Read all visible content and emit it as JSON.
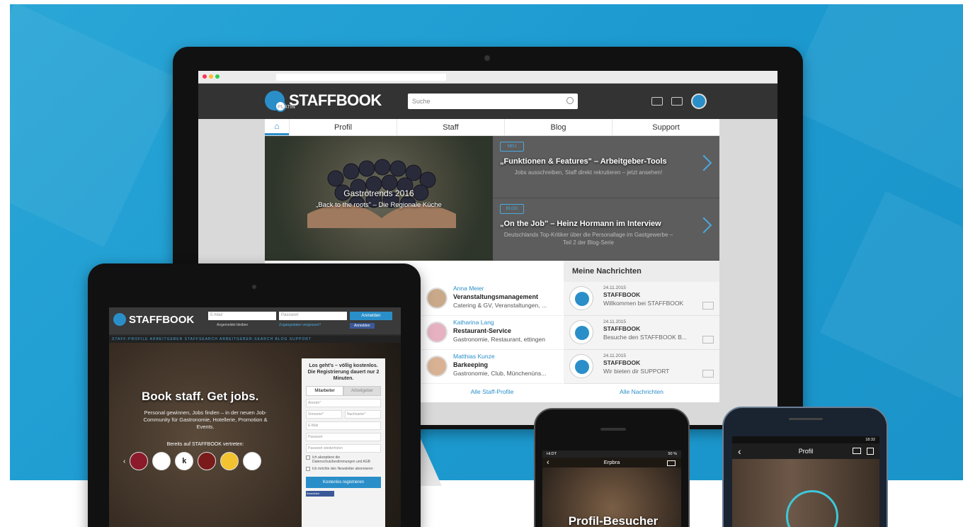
{
  "monitor": {
    "brand": "STAFFBOOK",
    "brand_sub": "PLATIN",
    "search_placeholder": "Suche",
    "nav": [
      "Profil",
      "Staff",
      "Blog",
      "Support"
    ],
    "hero": {
      "title": "Gastrotrends 2016",
      "subtitle": "„Back to the roots\" – Die Regionale Küche"
    },
    "teasers": [
      {
        "tag": "NEU",
        "title": "„Funktionen & Features\" – Arbeitgeber-Tools",
        "text": "Jobs ausschreiben, Staff direkt rekrutieren – jetzt ansehen!"
      },
      {
        "tag": "BLOG",
        "title": "„On the Job\" – Heinz Hormann im Interview",
        "text": "Deutschlands Top-Kritiker über die Personallage im Gastgewerbe – Teil 2 der Blog-Serie"
      }
    ],
    "profiles": [
      {
        "name": "Anna Meier",
        "role": "Veranstaltungsmanagement",
        "desc": "Catering & GV, Veranstaltungen, ..."
      },
      {
        "name": "Katharina Lang",
        "role": "Restaurant-Service",
        "desc": "Gastronomie, Restaurant, ettingen"
      },
      {
        "name": "Matthias Kunze",
        "role": "Barkeeping",
        "desc": "Gastronomie, Club, Münchenüns..."
      }
    ],
    "messages_title": "Meine Nachrichten",
    "messages": [
      {
        "date": "24.11.2015",
        "sender": "STAFFBOOK",
        "text": "Willkommen bei STAFFBOOK"
      },
      {
        "date": "24.11.2015",
        "sender": "STAFFBOOK",
        "text": "Besuche den STAFFBOOK B..."
      },
      {
        "date": "24.11.2015",
        "sender": "STAFFBOOK",
        "text": "Wir bieten dir SUPPORT"
      }
    ],
    "all_profiles": "Alle Staff-Profile",
    "all_messages": "Alle Nachrichten"
  },
  "tablet": {
    "brand": "STAFFBOOK",
    "email_placeholder": "E-Mail",
    "password_placeholder": "Passwort",
    "login": "Anmelden",
    "remember": "Angemeldet bleiben",
    "forgot": "Zugangsdaten vergessen?",
    "fb": "Anmelden",
    "nav": "STAFF-PROFILE   ARBEITGEBER   STAFFSEARCH   ARBEITGEBER-SEARCH   BLOG   SUPPORT",
    "headline": "Book staff. Get jobs.",
    "text": "Personal gewinnen, Jobs finden – in der neuen Job-Community für Gastronomie, Hotellerie, Promotion & Events.",
    "seen": "Bereits auf STAFFBOOK vertreten:",
    "form": {
      "heading": "Los geht's – völlig kostenlos. Die Registrierung dauert nur 2 Minuten.",
      "tab_staff": "Mitarbeiter",
      "tab_employer": "Arbeitgeber",
      "anrede": "Anrede*",
      "vorname": "Vorname*",
      "nachname": "Nachname*",
      "email": "E-Mail",
      "password": "Passwort",
      "password_repeat": "Passwort wiederholen",
      "terms": "Ich akzeptiere die Datenschutzbestimmungen und AGB",
      "newsletter": "Ich möchte den Newsletter abonnieren",
      "submit": "Kostenlos registrieren",
      "fb": "Anmelden"
    }
  },
  "iphone": {
    "status_left": "Hi:DT",
    "status_right": "50 %",
    "bar": "Erpbra",
    "title": "Profil-Besucher"
  },
  "android": {
    "status": "18:32",
    "bar": "Profil"
  }
}
